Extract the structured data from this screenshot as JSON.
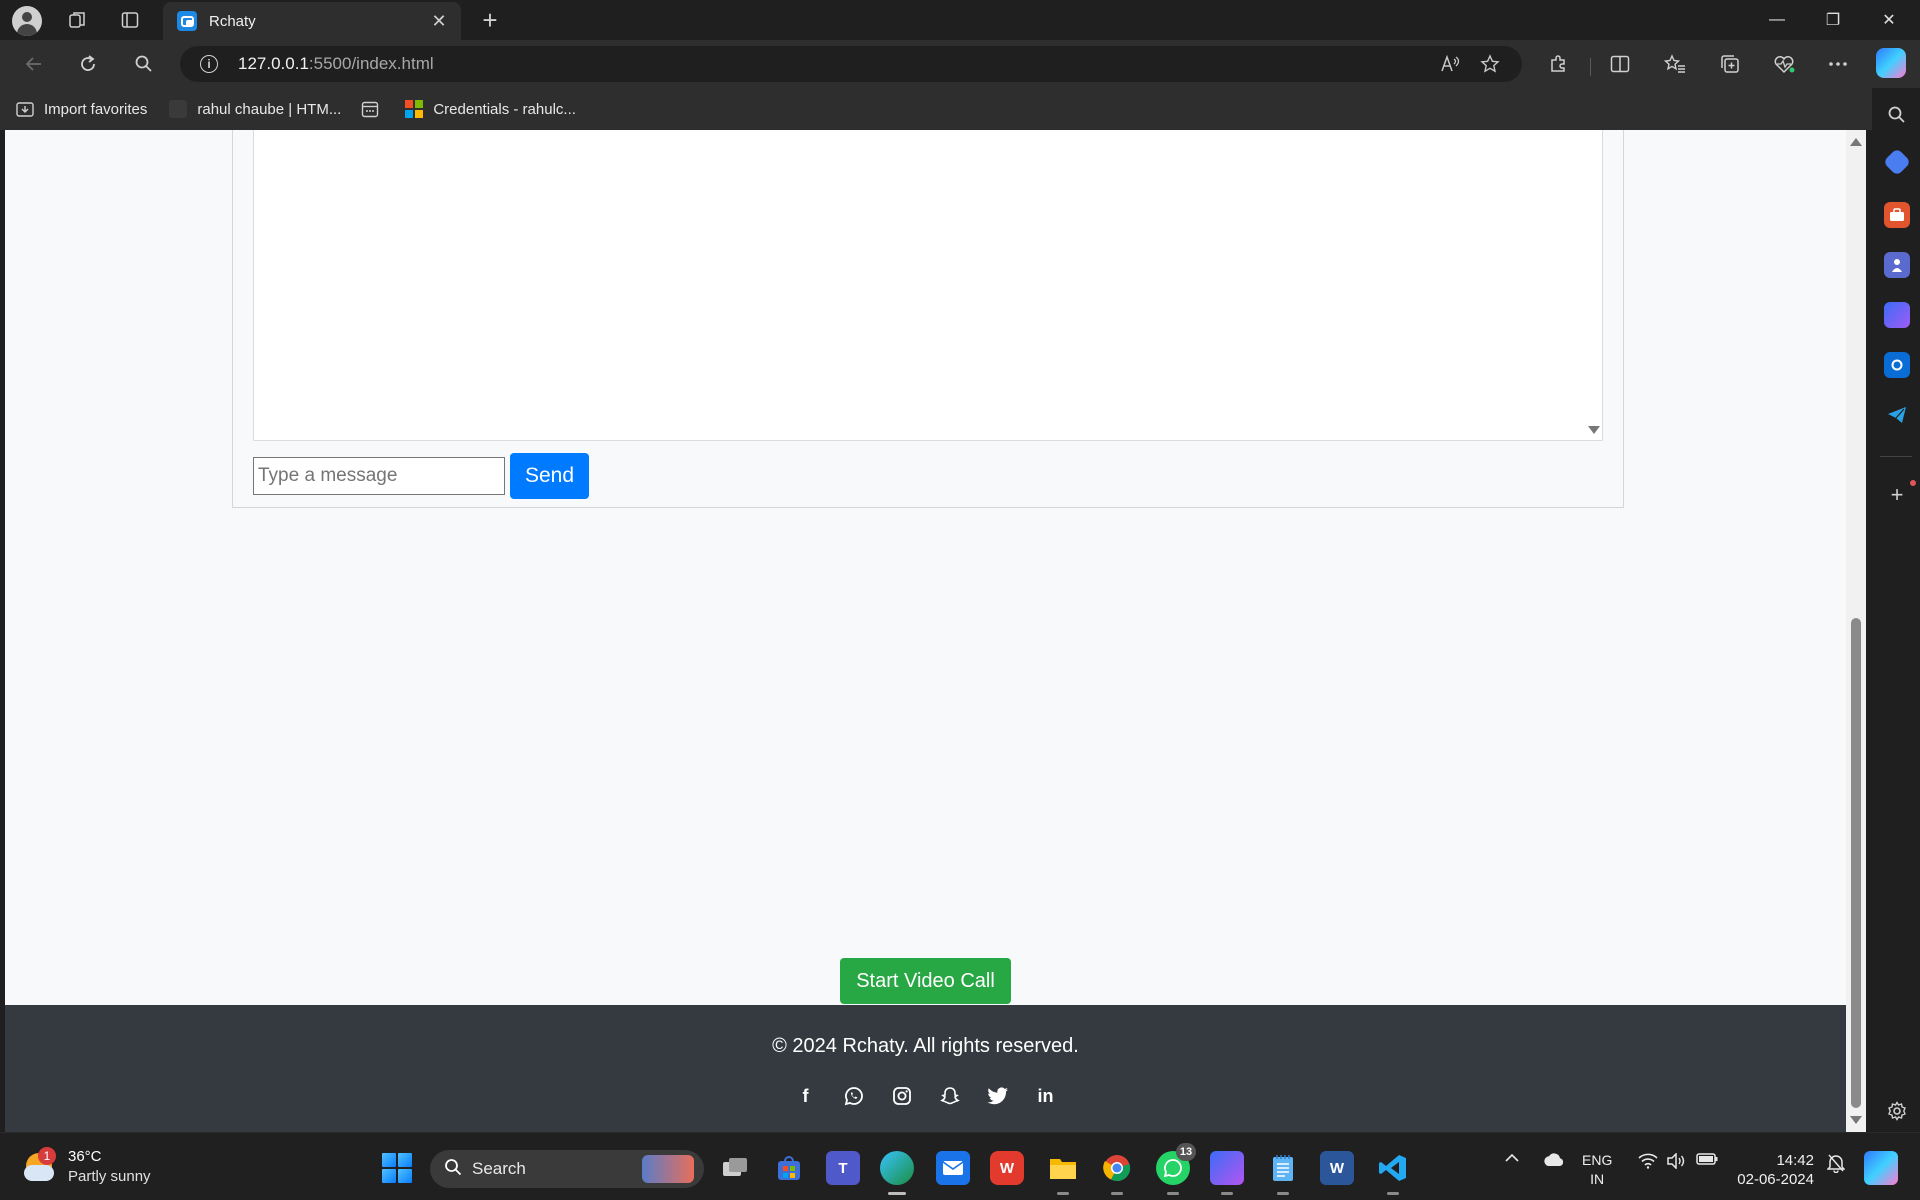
{
  "browser": {
    "tab_title": "Rchaty",
    "url_host": "127.0.0.1",
    "url_rest": ":5500/index.html",
    "icons": [
      "profile-icon",
      "workspaces-icon",
      "tab-actions-icon",
      "close-icon",
      "plus-icon",
      "back-icon",
      "refresh-icon",
      "search-icon",
      "info-icon",
      "read-aloud-icon",
      "favorite-star-icon",
      "extensions-icon",
      "split-screen-icon",
      "favorites-icon",
      "collections-icon",
      "browser-essentials-icon",
      "more-icon",
      "copilot-icon"
    ],
    "window_controls": {
      "minimize": "—",
      "restore": "❐",
      "close": "✕"
    }
  },
  "favorites": [
    {
      "label": "Import favorites",
      "icon": "import-icon"
    },
    {
      "label": "rahul chaube | HTM...",
      "icon": "bookmark-favicon"
    },
    {
      "label": "",
      "icon": "calendar-icon"
    },
    {
      "label": "Credentials - rahulc...",
      "icon": "microsoft-logo"
    }
  ],
  "chat": {
    "input_placeholder": "Type a message",
    "input_value": "",
    "send_label": "Send"
  },
  "video": {
    "button_label": "Start Video Call"
  },
  "footer": {
    "copyright": "© 2024 Rchaty. All rights reserved.",
    "socials": [
      "facebook-icon",
      "whatsapp-icon",
      "instagram-icon",
      "snapchat-icon",
      "twitter-icon",
      "linkedin-icon"
    ],
    "social_glyphs": {
      "facebook": "f",
      "linkedin": "in"
    }
  },
  "colors": {
    "send": "#007bff",
    "video": "#28a745",
    "footer_bg": "#343a40",
    "page_bg": "#f8f9fa"
  },
  "sidebar_icons": [
    "sidebar-search-icon",
    "shopping-icon",
    "tools-icon",
    "games-icon",
    "copilot-app-icon",
    "outlook-icon",
    "telegram-icon",
    "add-icon",
    "settings-icon"
  ],
  "taskbar": {
    "weather": {
      "badge": "1",
      "temp": "36°C",
      "desc": "Partly sunny"
    },
    "search_label": "Search",
    "apps": [
      {
        "name": "task-view"
      },
      {
        "name": "microsoft-store"
      },
      {
        "name": "teams",
        "glyph": "T"
      },
      {
        "name": "edge"
      },
      {
        "name": "mail"
      },
      {
        "name": "wps-office",
        "glyph": "W"
      },
      {
        "name": "file-explorer"
      },
      {
        "name": "chrome"
      },
      {
        "name": "whatsapp",
        "badge": "13"
      },
      {
        "name": "copilot"
      },
      {
        "name": "notepad"
      },
      {
        "name": "word",
        "glyph": "W"
      },
      {
        "name": "vscode"
      }
    ],
    "lang": {
      "line1": "ENG",
      "line2": "IN"
    },
    "clock": {
      "time": "14:42",
      "date": "02-06-2024"
    }
  }
}
